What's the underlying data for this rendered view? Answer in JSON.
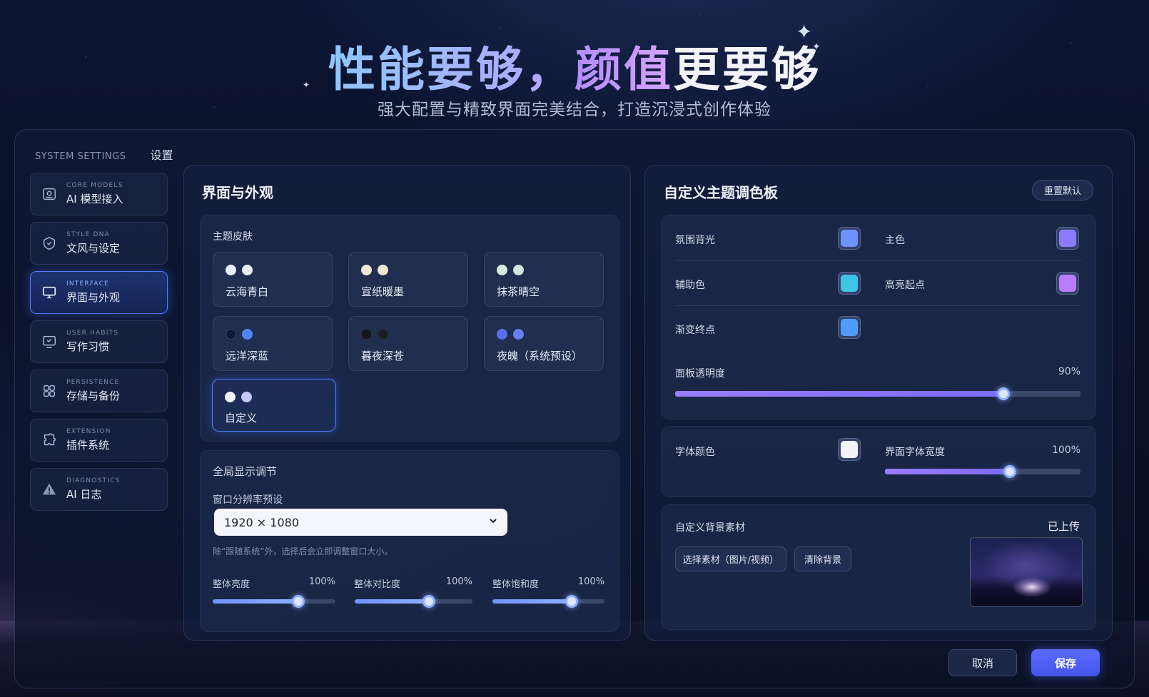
{
  "hero": {
    "title_part1": "性能要够，",
    "title_part2": "颜值",
    "title_part3": "更要够",
    "subtitle": "强大配置与精致界面完美结合，打造沉浸式创作体验"
  },
  "window": {
    "header_en": "SYSTEM SETTINGS",
    "header_zh": "设置"
  },
  "sidebar": {
    "items": [
      {
        "en": "CORE MODELS",
        "zh": "AI 模型接入",
        "icon": "model-icon"
      },
      {
        "en": "STYLE DNA",
        "zh": "文风与设定",
        "icon": "style-icon"
      },
      {
        "en": "INTERFACE",
        "zh": "界面与外观",
        "icon": "monitor-icon",
        "active": true
      },
      {
        "en": "USER HABITS",
        "zh": "写作习惯",
        "icon": "habits-icon"
      },
      {
        "en": "PERSISTENCE",
        "zh": "存储与备份",
        "icon": "storage-icon"
      },
      {
        "en": "EXTENSION",
        "zh": "插件系统",
        "icon": "puzzle-icon"
      },
      {
        "en": "DIAGNOSTICS",
        "zh": "AI 日志",
        "icon": "warning-icon"
      }
    ]
  },
  "appearance": {
    "title": "界面与外观",
    "theme_section": "主题皮肤",
    "themes": [
      {
        "name": "云海青白",
        "dots": [
          "#e8f0ff",
          "#e8eef8"
        ]
      },
      {
        "name": "宣纸暖墨",
        "dots": [
          "#f2e8d5",
          "#efe6cf"
        ]
      },
      {
        "name": "抹茶晴空",
        "dots": [
          "#d6eee0",
          "#cfe6da"
        ]
      },
      {
        "name": "远洋深蓝",
        "dots": [
          "#0e1a3a",
          "#4f86ff"
        ]
      },
      {
        "name": "暮夜深苍",
        "dots": [
          "#111418",
          "#1a1d22"
        ]
      },
      {
        "name": "夜魄（系统预设）",
        "dots": [
          "#5a6ff0",
          "#6a7ff5"
        ]
      },
      {
        "name": "自定义",
        "dots": [
          "#f4f6ff",
          "#c4c8ff"
        ],
        "active": true
      }
    ],
    "display_section": "全局显示调节",
    "resolution_label": "窗口分辨率预设",
    "resolution_value": "1920 × 1080",
    "resolution_hint": "除“跟随系统”外，选择后会立即调整窗口大小。",
    "sliders": [
      {
        "label": "整体亮度",
        "value_text": "100%",
        "fraction": 0.7
      },
      {
        "label": "整体对比度",
        "value_text": "100%",
        "fraction": 0.63
      },
      {
        "label": "整体饱和度",
        "value_text": "100%",
        "fraction": 0.71
      }
    ]
  },
  "palette": {
    "title": "自定义主题调色板",
    "reset_label": "重置默认",
    "colors": {
      "ambient": {
        "label": "氛围背光",
        "color": "#6f92ff"
      },
      "primary": {
        "label": "主色",
        "color": "#8a7cff"
      },
      "secondary": {
        "label": "辅助色",
        "color": "#3dc4e6"
      },
      "highlight_start": {
        "label": "高亮起点",
        "color": "#b77cff"
      },
      "gradient_end": {
        "label": "渐变终点",
        "color": "#4f9cff"
      }
    },
    "opacity": {
      "label": "面板透明度",
      "value_text": "90%",
      "fraction": 0.81
    },
    "font_color": {
      "label": "字体颜色",
      "color": "#f2f4fa"
    },
    "font_width": {
      "label": "界面字体宽度",
      "value_text": "100%",
      "fraction": 0.64
    },
    "background": {
      "label": "自定义背景素材",
      "status": "已上传",
      "choose_label": "选择素材（图片/视频）",
      "clear_label": "清除背景"
    }
  },
  "footer": {
    "cancel_label": "取消",
    "save_label": "保存"
  },
  "accent": "#4f7cff"
}
